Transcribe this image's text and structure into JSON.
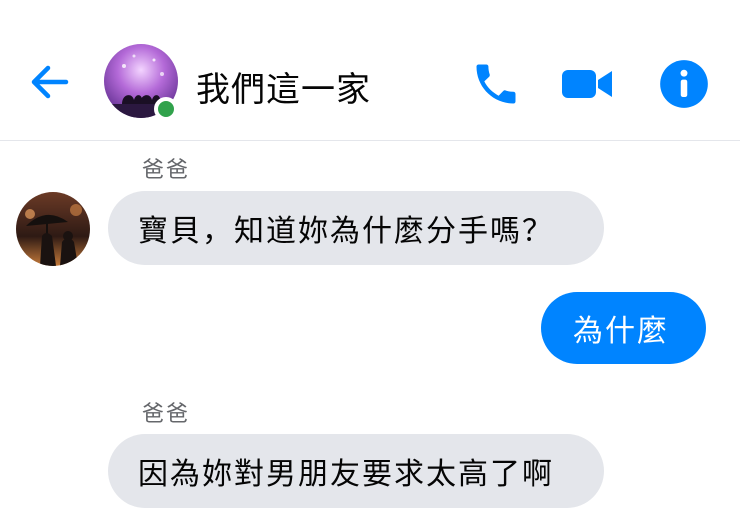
{
  "header": {
    "title": "我們這一家",
    "accent_color": "#0084ff",
    "online_color": "#31a24c",
    "back_icon": "arrow-left-icon",
    "phone_icon": "phone-icon",
    "video_icon": "video-camera-icon",
    "info_icon": "info-icon"
  },
  "messages": [
    {
      "sender": "爸爸",
      "direction": "incoming",
      "text": "寶貝，知道妳為什麼分手嗎？"
    },
    {
      "sender": "",
      "direction": "outgoing",
      "text": "為什麼"
    },
    {
      "sender": "爸爸",
      "direction": "incoming",
      "text": "因為妳對男朋友要求太高了啊"
    }
  ]
}
